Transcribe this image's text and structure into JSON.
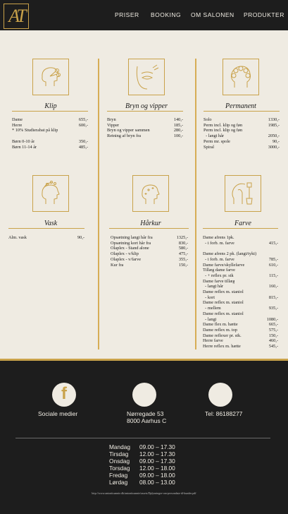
{
  "brand": {
    "logo_text": "AT",
    "accent_color": "#c9a24a"
  },
  "nav": {
    "items": [
      {
        "label": "PRISER"
      },
      {
        "label": "BOOKING"
      },
      {
        "label": "OM SALONEN"
      },
      {
        "label": "PRODUKTER"
      }
    ]
  },
  "sections": {
    "klip": {
      "title": "Klip",
      "icon": "head-scissors-icon",
      "rows": [
        {
          "name": "Dame",
          "price": "655,-"
        },
        {
          "name": "Herre",
          "price": "600,-"
        },
        {
          "name": "* 10% Studierabat på klip",
          "price": ""
        },
        {
          "name": "",
          "price": ""
        },
        {
          "name": "Børn 0-10 år",
          "price": "350,-"
        },
        {
          "name": "Børn 11-14 år",
          "price": "485,-"
        }
      ]
    },
    "bryn": {
      "title": "Bryn og vipper",
      "icon": "face-eye-icon",
      "rows": [
        {
          "name": "Bryn",
          "price": "140,-"
        },
        {
          "name": "Vipper",
          "price": "185,-"
        },
        {
          "name": "Bryn og vipper sammen",
          "price": "280,-"
        },
        {
          "name": "Retning af bryn fra",
          "price": "100,-"
        }
      ]
    },
    "permanent": {
      "title": "Permanent",
      "icon": "curlers-icon",
      "rows": [
        {
          "name": "Solo",
          "price": "1330,-"
        },
        {
          "name": "Perm incl. klip og føn",
          "price": "1985,-"
        },
        {
          "name": "Perm incl. klip og føn",
          "price": ""
        },
        {
          "name": "  - langt hår",
          "price": "2050,-"
        },
        {
          "name": "Perm mr. spole",
          "price": "90,-"
        },
        {
          "name": "Spiral",
          "price": "3000,-"
        }
      ]
    },
    "vask": {
      "title": "Vask",
      "icon": "head-wash-icon",
      "rows": [
        {
          "name": "Alm. vask",
          "price": "90,-"
        }
      ]
    },
    "harkur": {
      "title": "Hårkur",
      "icon": "head-sparkle-icon",
      "rows": [
        {
          "name": "Opsætning langt hår fra",
          "price": "1325,-"
        },
        {
          "name": "Opsætning kort hår fra",
          "price": "830,-"
        },
        {
          "name": "Olaplex - Stand alone",
          "price": "580,-"
        },
        {
          "name": "Olaplex - v/klip",
          "price": "475,-"
        },
        {
          "name": "Olaplex - v/farve",
          "price": "355,-"
        },
        {
          "name": "Kur fra",
          "price": "150,-"
        }
      ]
    },
    "farve": {
      "title": "Farve",
      "icon": "hair-dye-brush-icon",
      "rows": [
        {
          "name": "Dame afrens 1pk.",
          "price": ""
        },
        {
          "name": "  - i forb. m. farve",
          "price": "415,-"
        },
        {
          "name": "",
          "price": ""
        },
        {
          "name": "Dame afrens 2 pk. (langt/tykt)",
          "price": ""
        },
        {
          "name": "  - i forb. m. farve",
          "price": "785,-"
        },
        {
          "name": "Dame farve/skyllefarve",
          "price": "610,-"
        },
        {
          "name": "Tillæg dame farve",
          "price": ""
        },
        {
          "name": "  - + reflex pr. stk",
          "price": "115,-"
        },
        {
          "name": "Dame farve tillæg",
          "price": ""
        },
        {
          "name": "  - langt hår",
          "price": "160,-"
        },
        {
          "name": "Dame reflex m. staniol",
          "price": ""
        },
        {
          "name": "  - kort",
          "price": "815,-"
        },
        {
          "name": "Dame reflex m. staniol",
          "price": ""
        },
        {
          "name": "  - mellem",
          "price": "935,-"
        },
        {
          "name": "Dame reflex m. staniol",
          "price": ""
        },
        {
          "name": "  - langt",
          "price": "1080,-"
        },
        {
          "name": "Dame flex m. hætte",
          "price": "665,-"
        },
        {
          "name": "Dame reflex m. top",
          "price": "575,-"
        },
        {
          "name": "Dame reflexer pr. stk.",
          "price": "150,-"
        },
        {
          "name": "Herre farve",
          "price": "460,-"
        },
        {
          "name": "Herre reflex m. hætte",
          "price": "545,-"
        }
      ]
    }
  },
  "footer": {
    "social": {
      "icon": "facebook-icon",
      "glyph": "f",
      "label": "Sociale medier"
    },
    "address": {
      "icon": "location-icon",
      "line1": "Nørregade 53",
      "line2": "8000 Aarhus C"
    },
    "phone": {
      "icon": "phone-icon",
      "label": "Tel: 86188277"
    },
    "hours": [
      {
        "day": "Mandag",
        "time": "09.00 – 17.30"
      },
      {
        "day": "Tirsdag",
        "time": "12.00 – 17.30"
      },
      {
        "day": "Onsdag",
        "time": "09.00 – 17.30"
      },
      {
        "day": "Torsdag",
        "time": "12.00 – 18.00"
      },
      {
        "day": "Fredag",
        "time": "09.00 – 18.00"
      },
      {
        "day": "Lørdag",
        "time": "08.00 – 13.00"
      }
    ],
    "url": "http://www.antonitoannie.dk/antonitoannie/assets/Dplysninger-om-persondata-til-kunder.pdf"
  }
}
